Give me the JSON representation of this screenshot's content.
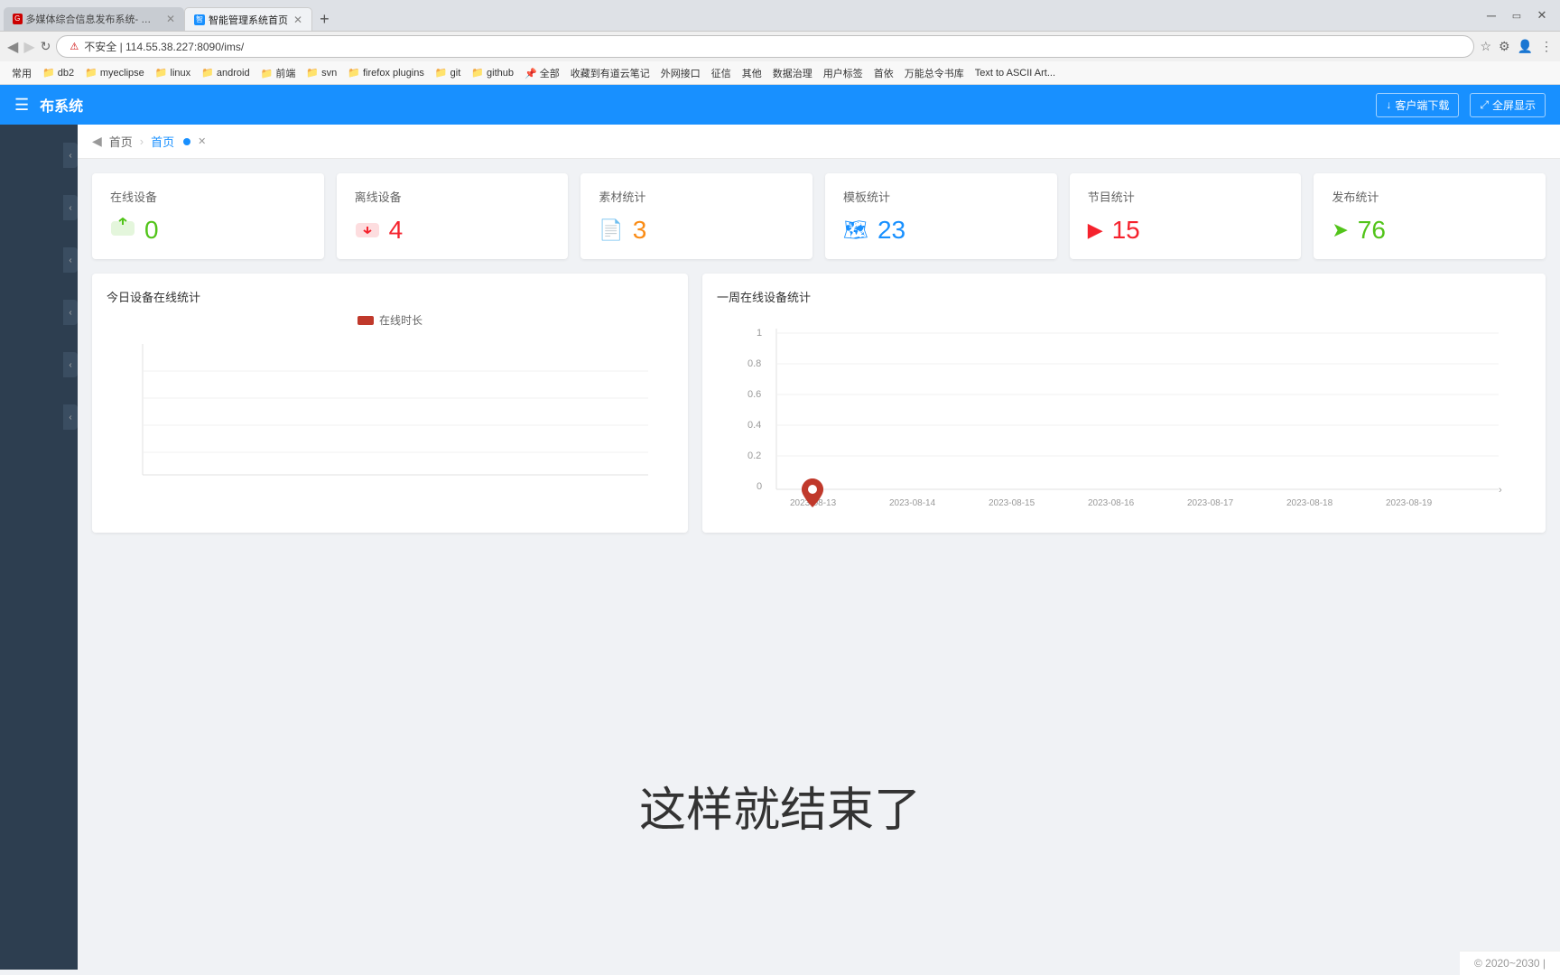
{
  "browser": {
    "tabs": [
      {
        "label": "多媒体综合信息发布系统- 企业版...",
        "active": false,
        "favicon_color": "#c00"
      },
      {
        "label": "智能管理系统首页",
        "active": true,
        "favicon_color": "#1890ff"
      }
    ],
    "url": "不安全 | 114.55.38.227:8090/ims/",
    "bookmarks": [
      "常用",
      "db2",
      "myeclipse",
      "linux",
      "android",
      "前端",
      "svn",
      "firefox plugins",
      "git",
      "github",
      "全部",
      "收藏到有道云笔记",
      "外网接口",
      "征信",
      "其他",
      "数据治理",
      "用户标签",
      "首依",
      "万能总令书库",
      "Text to ASCII Art..."
    ]
  },
  "app": {
    "title": "布系统",
    "menu_icon": "☰",
    "nav_buttons": [
      "客户端下载",
      "全屏显示"
    ]
  },
  "breadcrumb": {
    "back_label": "◀",
    "items": [
      "首页",
      "首页"
    ]
  },
  "stats": [
    {
      "title": "在线设备",
      "value": "0",
      "icon_type": "cloud-up",
      "color": "green"
    },
    {
      "title": "离线设备",
      "value": "4",
      "icon_type": "cloud-down",
      "color": "red"
    },
    {
      "title": "素材统计",
      "value": "3",
      "icon_type": "file",
      "color": "orange"
    },
    {
      "title": "模板统计",
      "value": "23",
      "icon_type": "book",
      "color": "blue"
    },
    {
      "title": "节目统计",
      "value": "15",
      "icon_type": "play",
      "color": "red"
    },
    {
      "title": "发布统计",
      "value": "76",
      "icon_type": "send",
      "color": "green"
    }
  ],
  "chart_left": {
    "title": "今日设备在线统计",
    "legend": "在线时长",
    "legend_color": "#c0392b"
  },
  "chart_right": {
    "title": "一周在线设备统计",
    "y_labels": [
      "1",
      "0.8",
      "0.6",
      "0.4",
      "0.2",
      "0"
    ],
    "x_labels": [
      "2023-08-13",
      "2023-08-14",
      "2023-08-15",
      "2023-08-16",
      "2023-08-17",
      "2023-08-18",
      "2023-08-19"
    ],
    "data_point": {
      "x": "2023-08-13",
      "y": 0,
      "label": "0"
    }
  },
  "overlay": {
    "text": "这样就结束了"
  },
  "footer": {
    "text": "© 2020~2030 |"
  },
  "sidebar": {
    "arrows": [
      "‹",
      "‹",
      "‹",
      "‹",
      "‹",
      "‹"
    ]
  }
}
